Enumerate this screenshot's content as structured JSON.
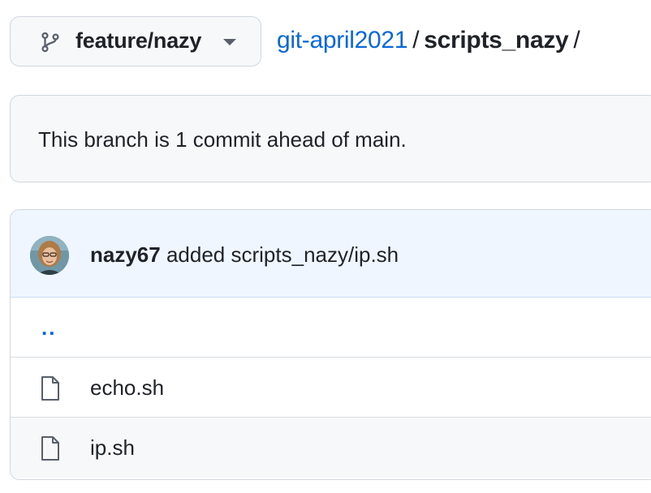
{
  "branch": {
    "name": "feature/nazy",
    "icon": "git-branch-icon"
  },
  "breadcrumb": {
    "repo": "git-april2021",
    "separator": "/",
    "dir": "scripts_nazy",
    "trailing": "/"
  },
  "branch_status": {
    "text": "This branch is 1 commit ahead of main."
  },
  "latest_commit": {
    "author": "nazy67",
    "message": "added scripts_nazy/ip.sh"
  },
  "files": {
    "parent": "..",
    "items": [
      {
        "name": "echo.sh",
        "icon": "file-icon"
      },
      {
        "name": "ip.sh",
        "icon": "file-icon"
      }
    ]
  },
  "colors": {
    "link": "#0969da",
    "border": "#d0d7de",
    "commit_bg": "#f0f6ff"
  }
}
